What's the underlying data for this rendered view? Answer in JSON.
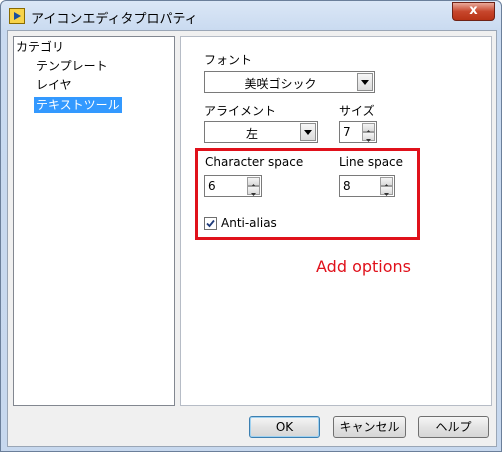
{
  "window": {
    "title": "アイコンエディタプロパティ",
    "close_glyph": "x"
  },
  "tree": {
    "items": [
      {
        "label": "カテゴリ"
      },
      {
        "label": "テンプレート"
      },
      {
        "label": "レイヤ"
      },
      {
        "label": "テキストツール",
        "selected": true
      }
    ]
  },
  "panel": {
    "font_label": "フォント",
    "font_value": "美咲ゴシック",
    "align_label": "アライメント",
    "align_value": "左",
    "size_label": "サイズ",
    "size_value": "7",
    "char_space_label": "Character space",
    "char_space_value": "6",
    "line_space_label": "Line space",
    "line_space_value": "8",
    "antialias_label": "Anti-alias",
    "antialias_checked": true
  },
  "annotation": {
    "text": "Add options",
    "color": "#e0111b"
  },
  "buttons": {
    "ok": "OK",
    "cancel": "キャンセル",
    "help": "ヘルプ"
  },
  "colors": {
    "selection": "#3399ff",
    "highlight_box": "#e0111b"
  }
}
